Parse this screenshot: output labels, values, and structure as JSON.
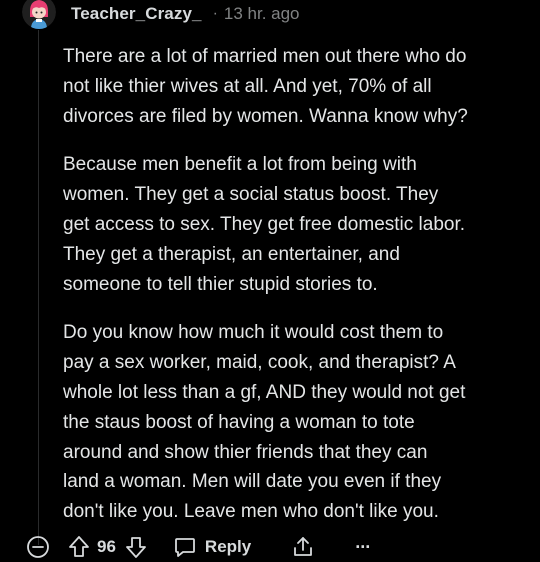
{
  "comment": {
    "username": "Teacher_Crazy_",
    "separator": "·",
    "time": "13 hr. ago",
    "paragraphs": [
      "There are a lot of married men out there who do\nnot like thier wives at all. And yet, 70% of all\ndivorces are filed by women. Wanna know why?",
      "Because men benefit a lot from being with\nwomen. They get a social status boost. They\nget access to sex. They get free domestic labor.\nThey get a therapist, an entertainer, and\nsomeone to tell thier stupid stories to.",
      "Do you know how much it would cost them to\npay a sex worker, maid, cook, and therapist? A\nwhole lot less than a gf, AND they would not get\nthe staus boost of having a woman to tote\naround and show thier friends that they can\nland a woman. Men will date you even if they\ndon't like you. Leave men who don't like you."
    ]
  },
  "actions": {
    "score": "96",
    "reply_label": "Reply",
    "more_label": "···"
  },
  "icons": {
    "collapse": "minus-circle-icon",
    "upvote": "arrow-up-icon",
    "downvote": "arrow-down-icon",
    "reply": "speech-bubble-icon",
    "share": "share-icon",
    "more": "ellipsis-icon"
  },
  "colors": {
    "background": "#000000",
    "text": "#d7dadc",
    "meta": "#818384",
    "avatar_pink": "#e83e72"
  }
}
